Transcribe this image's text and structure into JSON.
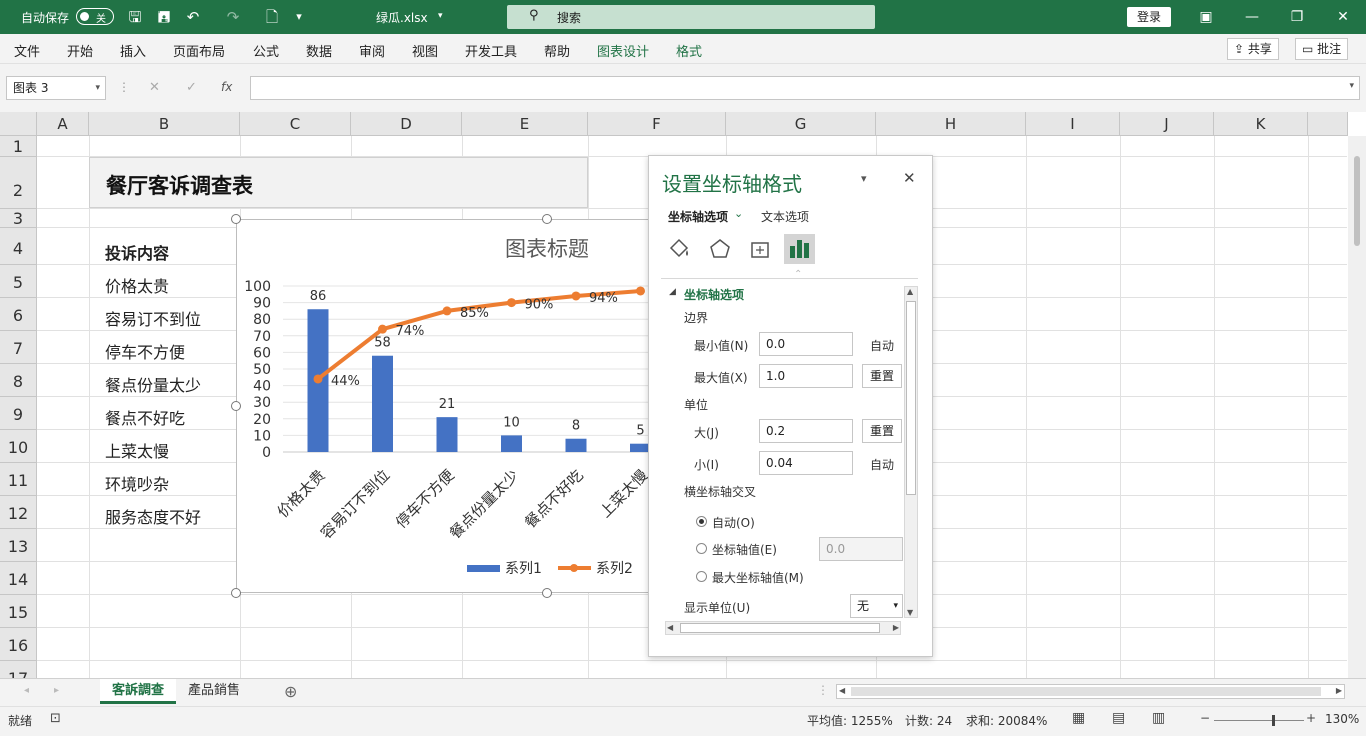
{
  "titlebar": {
    "autosave_label": "自动保存",
    "autosave_state": "关",
    "filename": "绿瓜.xlsx",
    "search_placeholder": "搜索",
    "login_label": "登录"
  },
  "menu": {
    "items": [
      "文件",
      "开始",
      "插入",
      "页面布局",
      "公式",
      "数据",
      "审阅",
      "视图",
      "开发工具",
      "帮助",
      "图表设计",
      "格式"
    ],
    "share_label": "共享",
    "comment_label": "批注"
  },
  "formula": {
    "namebox": "图表 3",
    "fx": "fx"
  },
  "grid": {
    "columns": [
      "A",
      "B",
      "C",
      "D",
      "E",
      "F",
      "G",
      "H",
      "I",
      "J",
      "K"
    ],
    "rows": [
      "1",
      "2",
      "3",
      "4",
      "5",
      "6",
      "7",
      "8",
      "9",
      "10",
      "11",
      "12",
      "13",
      "14",
      "15",
      "16",
      "17"
    ],
    "title_cell": "餐厅客诉调查表",
    "header_cell": "投诉内容",
    "complaints": [
      "价格太贵",
      "容易订不到位",
      "停车不方便",
      "餐点份量太少",
      "餐点不好吃",
      "上菜太慢",
      "环境吵杂",
      "服务态度不好"
    ]
  },
  "chart_data": {
    "type": "bar",
    "title": "图表标题",
    "categories": [
      "价格太贵",
      "容易订不到位",
      "停车不方便",
      "餐点份量太少",
      "餐点不好吃",
      "上菜太慢"
    ],
    "series": [
      {
        "name": "系列1",
        "type": "bar",
        "values": [
          86,
          58,
          21,
          10,
          8,
          5
        ],
        "color": "#4472c4"
      },
      {
        "name": "系列2",
        "type": "line",
        "values": [
          44,
          74,
          85,
          90,
          94,
          97
        ],
        "labels": [
          "44%",
          "74%",
          "85%",
          "90%",
          "94%",
          ""
        ],
        "color": "#ed7d31"
      }
    ],
    "y_ticks": [
      "0",
      "10",
      "20",
      "30",
      "40",
      "50",
      "60",
      "70",
      "80",
      "90",
      "100"
    ],
    "ylim": [
      0,
      100
    ],
    "legend": "bottom"
  },
  "pane": {
    "title": "设置坐标轴格式",
    "tab_axis": "坐标轴选项",
    "tab_text": "文本选项",
    "section": "坐标轴选项",
    "bounds_label": "边界",
    "min_label": "最小值(N)",
    "min_value": "0.0",
    "min_state": "自动",
    "max_label": "最大值(X)",
    "max_value": "1.0",
    "max_state": "重置",
    "unit_label": "单位",
    "major_label": "大(J)",
    "major_value": "0.2",
    "major_state": "重置",
    "minor_label": "小(I)",
    "minor_value": "0.04",
    "minor_state": "自动",
    "cross_label": "横坐标轴交叉",
    "opt_auto": "自动(O)",
    "opt_value": "坐标轴值(E)",
    "opt_value_input": "0.0",
    "opt_max": "最大坐标轴值(M)",
    "display_unit_label": "显示单位(U)",
    "display_unit_value": "无"
  },
  "sheets": {
    "tabs": [
      "客訴調查",
      "產品銷售"
    ],
    "active": "客訴調查"
  },
  "status": {
    "ready": "就绪",
    "average": "平均值: 1255%",
    "count": "计数: 24",
    "sum": "求和: 20084%",
    "zoom": "130%"
  }
}
